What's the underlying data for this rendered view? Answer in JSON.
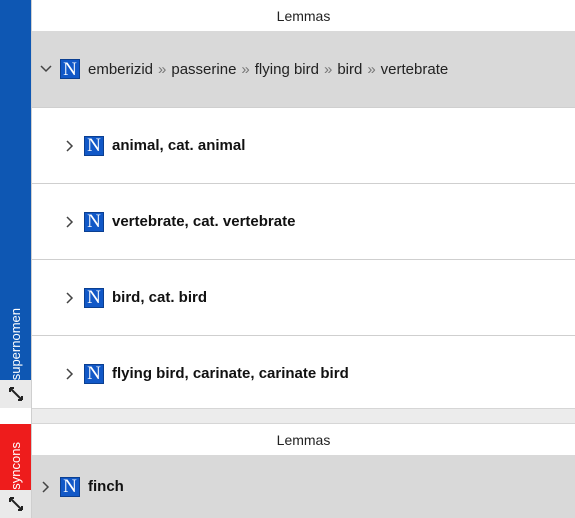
{
  "tabs": {
    "supernomen": "supernomen",
    "syncons": "syncons"
  },
  "colors": {
    "supernomen_tab": "#0e57b3",
    "syncons_tab": "#ee1c1c",
    "selected_row": "#d9d9d9",
    "n_icon": "#1158c7"
  },
  "icons": {
    "lemma": "noun-n-icon",
    "expand": "chevron-right-icon",
    "collapse": "chevron-down-icon",
    "resize": "resize-arrows-icon"
  },
  "supernomen_panel": {
    "header": "Lemmas",
    "path": {
      "n_glyph": "N",
      "crumbs": [
        "emberizid",
        "passerine",
        "flying bird",
        "bird",
        "vertebrate"
      ],
      "separator": "»"
    },
    "children": [
      {
        "n_glyph": "N",
        "label": "animal, cat. animal"
      },
      {
        "n_glyph": "N",
        "label": "vertebrate, cat. vertebrate"
      },
      {
        "n_glyph": "N",
        "label": "bird, cat. bird"
      },
      {
        "n_glyph": "N",
        "label": "flying bird, carinate, carinate bird"
      }
    ]
  },
  "syncons_panel": {
    "header": "Lemmas",
    "rows": [
      {
        "n_glyph": "N",
        "label": "finch"
      }
    ]
  }
}
